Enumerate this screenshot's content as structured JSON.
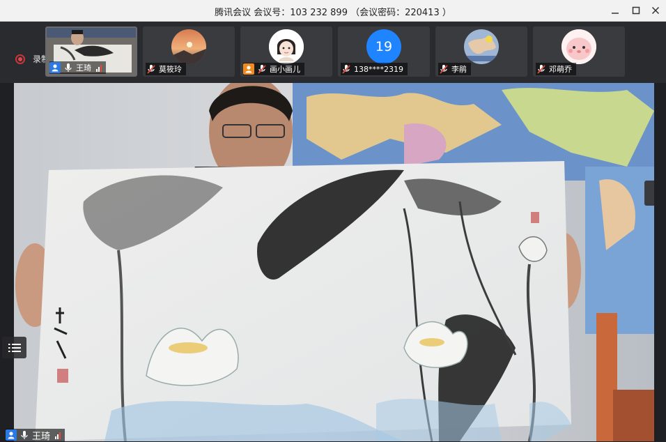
{
  "window": {
    "title": "腾讯会议 会议号：103 232 899 （会议密码：220413 ）",
    "controls": {
      "minimize": "—",
      "maximize": "☐",
      "close": "✕"
    }
  },
  "recording": {
    "label": "录制中"
  },
  "participants": [
    {
      "name": "王琦",
      "role_icon": "user-icon",
      "mic": "mic-on-icon",
      "signal": true,
      "active": true
    },
    {
      "name": "莫筱玲",
      "mic": "mic-muted-icon"
    },
    {
      "name": "画小画儿",
      "role_icon": "user-icon",
      "mic": "mic-muted-icon"
    },
    {
      "name": "138****2319",
      "avatar_number": "19",
      "mic": "mic-muted-icon"
    },
    {
      "name": "李鹃",
      "mic": "mic-muted-icon"
    },
    {
      "name": "邓萌乔",
      "mic": "mic-muted-icon"
    }
  ],
  "main_video": {
    "speaker_name": "王琦"
  },
  "colors": {
    "accent": "#2b7ae4",
    "muted": "#e04b3c",
    "record": "#e0464b"
  }
}
